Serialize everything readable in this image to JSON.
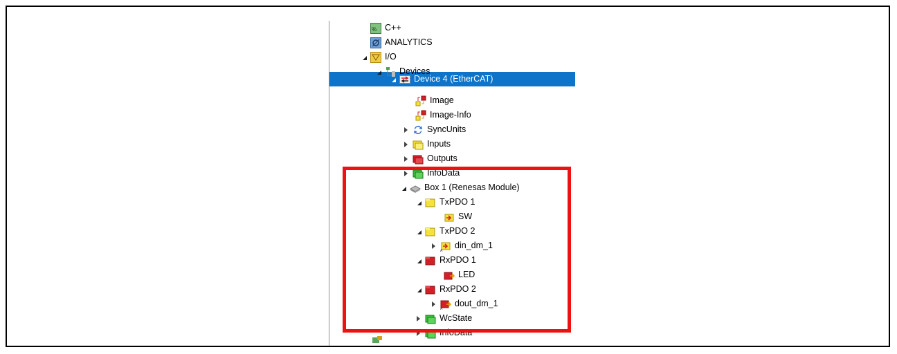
{
  "tree": {
    "items": [
      {
        "label": "C++",
        "icon": "cpp-project-icon",
        "state": "none"
      },
      {
        "label": "ANALYTICS",
        "icon": "analytics-icon",
        "state": "none"
      },
      {
        "label": "I/O",
        "icon": "io-icon",
        "state": "expanded"
      },
      {
        "label": "Devices",
        "icon": "devices-icon",
        "state": "expanded"
      },
      {
        "label": "Device 4 (EtherCAT)",
        "icon": "ethercat-device-icon",
        "state": "expanded",
        "selected": true
      },
      {
        "label": "Image",
        "icon": "image-icon",
        "state": "none"
      },
      {
        "label": "Image-Info",
        "icon": "image-info-icon",
        "state": "none"
      },
      {
        "label": "SyncUnits",
        "icon": "syncunits-icon",
        "state": "collapsed"
      },
      {
        "label": "Inputs",
        "icon": "inputs-icon",
        "state": "collapsed"
      },
      {
        "label": "Outputs",
        "icon": "outputs-icon",
        "state": "collapsed"
      },
      {
        "label": "InfoData",
        "icon": "infodata-icon",
        "state": "collapsed"
      },
      {
        "label": "Box 1 (Renesas Module)",
        "icon": "box-module-icon",
        "state": "expanded"
      },
      {
        "label": "TxPDO 1",
        "icon": "txpdo-icon",
        "state": "expanded"
      },
      {
        "label": "SW",
        "icon": "input-variable-icon",
        "state": "none"
      },
      {
        "label": "TxPDO 2",
        "icon": "txpdo-icon",
        "state": "expanded"
      },
      {
        "label": "din_dm_1",
        "icon": "input-variable-icon",
        "state": "collapsed"
      },
      {
        "label": "RxPDO 1",
        "icon": "rxpdo-icon",
        "state": "expanded"
      },
      {
        "label": "LED",
        "icon": "output-variable-icon",
        "state": "none"
      },
      {
        "label": "RxPDO 2",
        "icon": "rxpdo-icon",
        "state": "expanded"
      },
      {
        "label": "dout_dm_1",
        "icon": "output-variable-icon",
        "state": "collapsed"
      },
      {
        "label": "WcState",
        "icon": "wcstate-icon",
        "state": "collapsed"
      },
      {
        "label": "InfoData",
        "icon": "infodata-icon",
        "state": "collapsed"
      }
    ]
  },
  "colors": {
    "selection": "#0d74c9",
    "highlight_border": "#ee1111",
    "input_yellow": "#f6e33a",
    "output_red": "#d32027",
    "status_green": "#3cc03c"
  }
}
